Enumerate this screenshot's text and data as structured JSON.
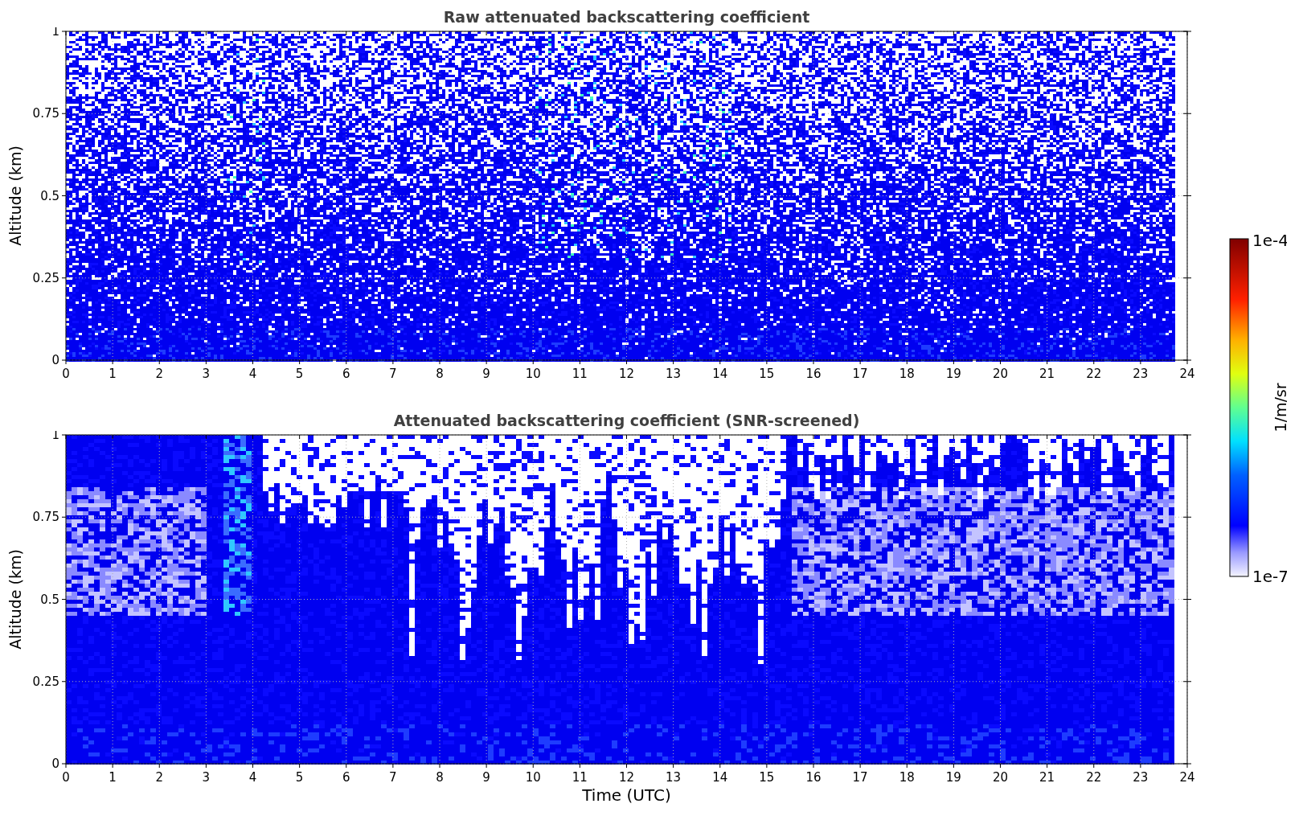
{
  "panels": [
    {
      "kind": "raw",
      "title": "Raw attenuated backscattering coefficient",
      "ylabel": "Altitude (km)",
      "yticks": [
        "1",
        "0.75",
        "0.5",
        "0.25",
        "0"
      ],
      "xticks": [
        "0",
        "1",
        "2",
        "3",
        "4",
        "5",
        "6",
        "7",
        "8",
        "9",
        "10",
        "11",
        "12",
        "13",
        "14",
        "15",
        "16",
        "17",
        "18",
        "19",
        "20",
        "21",
        "22",
        "23",
        "24"
      ]
    },
    {
      "kind": "screened",
      "title": "Attenuated backscattering coefficient (SNR-screened)",
      "ylabel": "Altitude (km)",
      "yticks": [
        "1",
        "0.75",
        "0.5",
        "0.25",
        "0"
      ],
      "xticks": [
        "0",
        "1",
        "2",
        "3",
        "4",
        "5",
        "6",
        "7",
        "8",
        "9",
        "10",
        "11",
        "12",
        "13",
        "14",
        "15",
        "16",
        "17",
        "18",
        "19",
        "20",
        "21",
        "22",
        "23",
        "24"
      ],
      "xlabel": "Time (UTC)"
    }
  ],
  "colorbar": {
    "max": "1e-4",
    "min": "1e-7",
    "label": "1/m/sr"
  }
}
